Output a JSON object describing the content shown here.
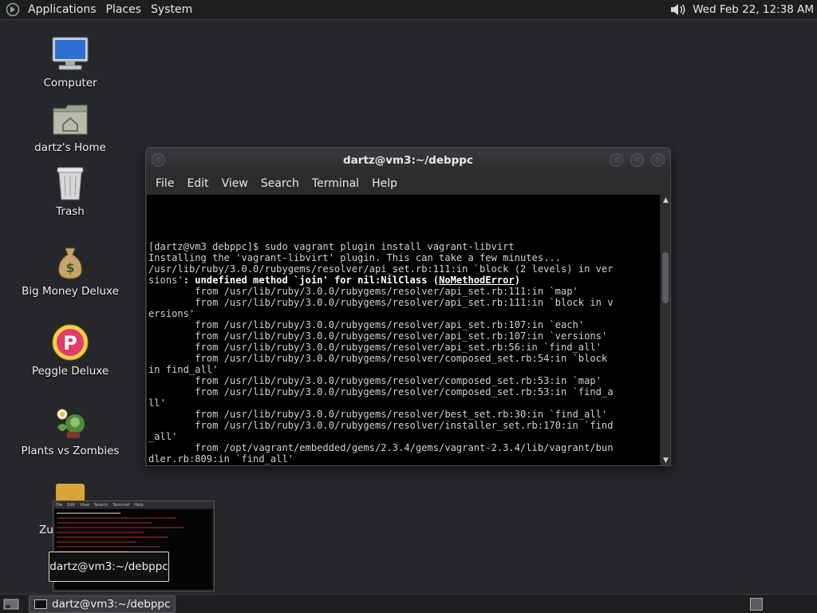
{
  "top_panel": {
    "menus": [
      "Applications",
      "Places",
      "System"
    ],
    "clock": "Wed Feb 22, 12:38 AM",
    "icons": {
      "logo": "gnome-foot-icon",
      "volume": "volume-icon"
    }
  },
  "desktop": {
    "icons": [
      {
        "label": "Computer",
        "icon": "computer-icon"
      },
      {
        "label": "dartz's Home",
        "icon": "home-folder-icon"
      },
      {
        "label": "Trash",
        "icon": "trash-icon"
      },
      {
        "label": "Big Money Deluxe",
        "icon": "money-bag-icon"
      },
      {
        "label": "Peggle Deluxe",
        "icon": "peggle-icon"
      },
      {
        "label": "Plants vs Zombies",
        "icon": "plants-vs-zombies-icon"
      }
    ],
    "partial_label": "Zu"
  },
  "terminal": {
    "title": "dartz@vm3:~/debppc",
    "menu": [
      "File",
      "Edit",
      "View",
      "Search",
      "Terminal",
      "Help"
    ],
    "lines": [
      "[dartz@vm3 debppc]$ sudo vagrant plugin install vagrant-libvirt",
      "Installing the 'vagrant-libvirt' plugin. This can take a few minutes...",
      "/usr/lib/ruby/3.0.0/rubygems/resolver/api_set.rb:111:in `block (2 levels) in ver",
      "sions': undefined method `join' for nil:NilClass (NoMethodError)",
      "        from /usr/lib/ruby/3.0.0/rubygems/resolver/api_set.rb:111:in `map'",
      "        from /usr/lib/ruby/3.0.0/rubygems/resolver/api_set.rb:111:in `block in v",
      "ersions'",
      "        from /usr/lib/ruby/3.0.0/rubygems/resolver/api_set.rb:107:in `each'",
      "        from /usr/lib/ruby/3.0.0/rubygems/resolver/api_set.rb:107:in `versions'",
      "        from /usr/lib/ruby/3.0.0/rubygems/resolver/api_set.rb:56:in `find_all'",
      "        from /usr/lib/ruby/3.0.0/rubygems/resolver/composed_set.rb:54:in `block",
      "in find_all'",
      "        from /usr/lib/ruby/3.0.0/rubygems/resolver/composed_set.rb:53:in `map'",
      "        from /usr/lib/ruby/3.0.0/rubygems/resolver/composed_set.rb:53:in `find_a",
      "ll'",
      "        from /usr/lib/ruby/3.0.0/rubygems/resolver/best_set.rb:30:in `find_all'",
      "        from /usr/lib/ruby/3.0.0/rubygems/resolver/installer_set.rb:170:in `find",
      "_all'",
      "        from /opt/vagrant/embedded/gems/2.3.4/gems/vagrant-2.3.4/lib/vagrant/bun",
      "dler.rb:809:in `find_all'"
    ],
    "error_line": {
      "prefix": "sions'",
      "bold": ": undefined method `join' for nil:NilClass (",
      "underlined": "NoMethodError",
      "suffix": ")"
    },
    "scroll_up": "▲",
    "scroll_down": "▼"
  },
  "thumbnail": {
    "menu": [
      "File",
      "Edit",
      "View",
      "Search",
      "Terminal",
      "Help"
    ]
  },
  "tooltip": "dartz@vm3:~/debppc",
  "bottom_panel": {
    "task_label": "dartz@vm3:~/debppc"
  },
  "colors": {
    "desktop": "#26272a",
    "panel": "#1d1e20",
    "terminal_bg": "#000000",
    "terminal_fg": "#d2d2d2"
  }
}
